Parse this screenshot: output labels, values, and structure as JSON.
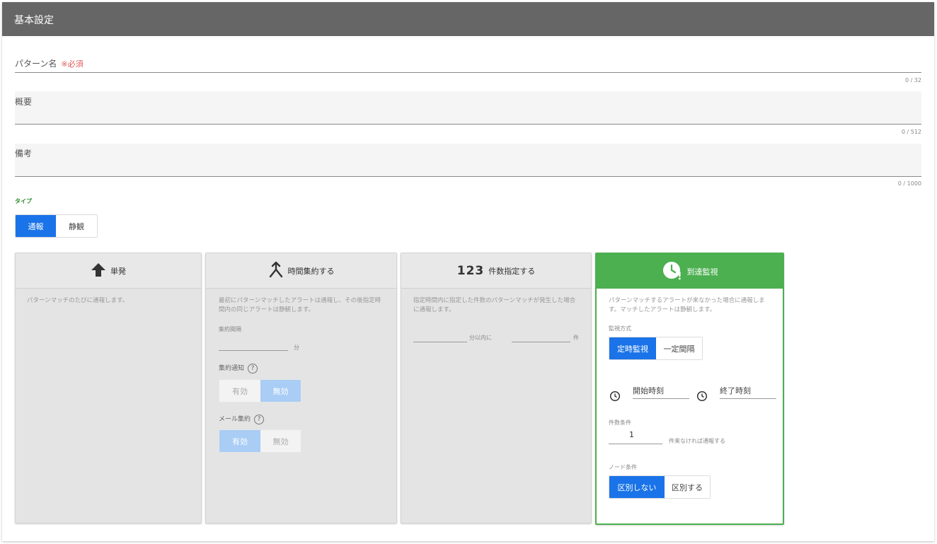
{
  "header": {
    "title": "基本設定"
  },
  "form": {
    "pattern_name": {
      "label": "パターン名",
      "required": "※必須",
      "counter": "0 / 32"
    },
    "summary": {
      "label": "概要",
      "counter": "0 / 512"
    },
    "remarks": {
      "label": "備考",
      "counter": "0 / 1000"
    },
    "type": {
      "label": "タイプ",
      "options": [
        "通報",
        "静観"
      ],
      "selected": "通報"
    }
  },
  "cards": {
    "single": {
      "title": "単発",
      "description": "パターンマッチのたびに通報します。"
    },
    "time_aggregate": {
      "title": "時間集約する",
      "description": "最初にパターンマッチしたアラートは通報し、その後指定時間内の同じアラートは静観します。",
      "interval_label": "集約間隔",
      "interval_unit": "分",
      "notify_label": "集約通知",
      "notify_options": [
        "有効",
        "無効"
      ],
      "notify_selected": "無効",
      "mail_label": "メール集約",
      "mail_options": [
        "有効",
        "無効"
      ],
      "mail_selected": "有効",
      "help_glyph": "?"
    },
    "count": {
      "title": "件数指定する",
      "icon_text": "123",
      "description": "指定時間内に指定した件数のパターンマッチが発生した場合に通報します。",
      "within_label": "分以内に",
      "count_unit": "件"
    },
    "arrival": {
      "title": "到達監視",
      "description": "パターンマッチするアラートが来なかった場合に通報します。マッチしたアラートは静観します。",
      "method_label": "監視方式",
      "method_options": [
        "定時監視",
        "一定間隔"
      ],
      "method_selected": "定時監視",
      "start_placeholder": "開始時刻",
      "end_placeholder": "終了時刻",
      "count_label": "件数条件",
      "count_value": "1",
      "count_suffix": "件来なければ通報する",
      "node_label": "ノード条件",
      "node_options": [
        "区別しない",
        "区別する"
      ],
      "node_selected": "区別しない"
    }
  },
  "colors": {
    "header": "#666666",
    "primary": "#1a73e8",
    "active_green": "#4caf50",
    "required_red": "#e05a5a"
  },
  "icons": [
    "arrow-up-icon",
    "merge-icon",
    "clock-alert-icon",
    "clock-icon",
    "help-icon"
  ]
}
